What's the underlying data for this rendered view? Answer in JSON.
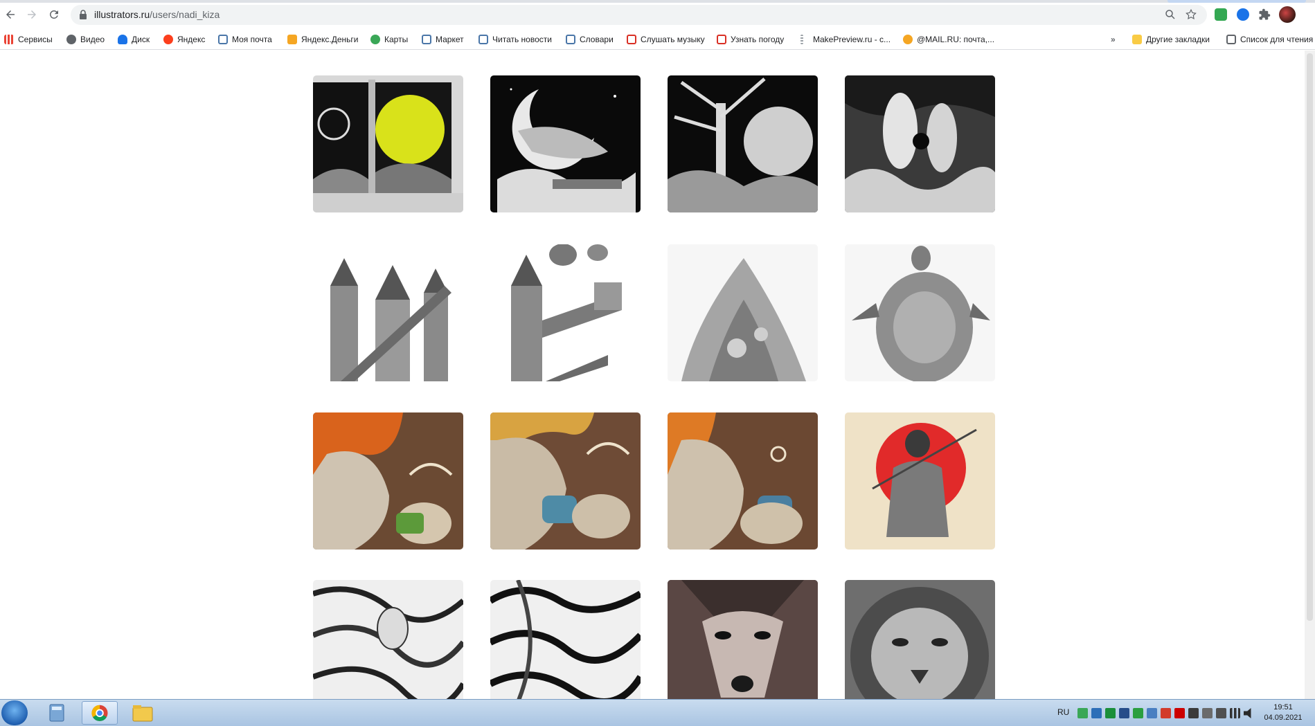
{
  "browser": {
    "url_host": "illustrators.ru",
    "url_path": "/users/nadi_kiza",
    "bookmarks": [
      {
        "label": "Сервисы",
        "color": "#e8453c"
      },
      {
        "label": "Видео",
        "color": "#5f6368"
      },
      {
        "label": "Диск",
        "color": "#1a73e8"
      },
      {
        "label": "Яндекс",
        "color": "#fc3f1d"
      },
      {
        "label": "Моя почта",
        "color": "#4a76a8"
      },
      {
        "label": "Яндекс.Деньги",
        "color": "#f5a623"
      },
      {
        "label": "Карты",
        "color": "#3aa757"
      },
      {
        "label": "Маркет",
        "color": "#4a76a8"
      },
      {
        "label": "Читать новости",
        "color": "#4a76a8"
      },
      {
        "label": "Словари",
        "color": "#4a76a8"
      },
      {
        "label": "Слушать музыку",
        "color": "#d93025"
      },
      {
        "label": "Узнать погоду",
        "color": "#d93025"
      },
      {
        "label": "MakePreview.ru - с...",
        "color": "#9aa0a6"
      },
      {
        "label": "@MAIL.RU: почта,...",
        "color": "#f5a623"
      }
    ],
    "overflow_label": "»",
    "other_bookmarks": "Другие закладки",
    "reading_list": "Список для чтения"
  },
  "gallery": {
    "items": [
      {
        "icon": "book-gogol-fantasy-illustration"
      },
      {
        "icon": "moon-woman-night-illustration"
      },
      {
        "icon": "tree-full-moon-illustration"
      },
      {
        "icon": "couple-waves-illustration"
      },
      {
        "icon": "castle-stairs-illustration"
      },
      {
        "icon": "castle-balloons-illustration"
      },
      {
        "icon": "coral-island-illustration"
      },
      {
        "icon": "turtle-illustration"
      },
      {
        "icon": "coffee-woman-green-cup-illustration"
      },
      {
        "icon": "coffee-woman-blue-cup-illustration"
      },
      {
        "icon": "coffee-woman-orange-illustration"
      },
      {
        "icon": "geisha-red-sun-illustration"
      },
      {
        "icon": "ornamental-girl-illustration"
      },
      {
        "icon": "ornamental-waves-illustration"
      },
      {
        "icon": "wolf-ornament-illustration"
      },
      {
        "icon": "lion-ornament-illustration"
      }
    ]
  },
  "taskbar": {
    "language": "RU",
    "time": "19:51",
    "date": "04.09.2021"
  }
}
